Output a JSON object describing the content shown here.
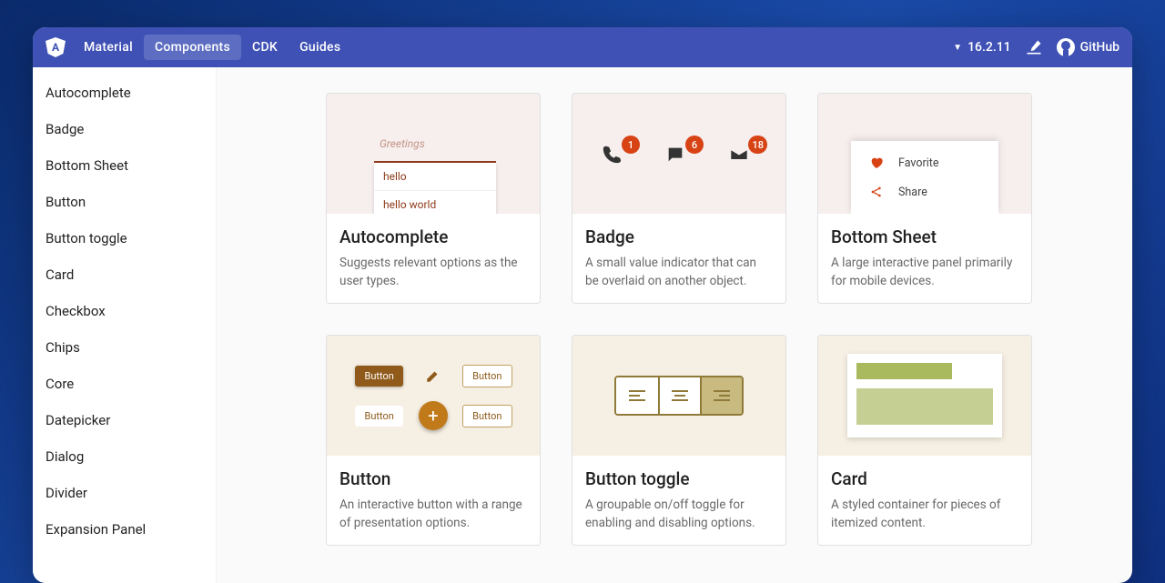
{
  "nav": {
    "brand": "Material",
    "items": [
      {
        "label": "Components"
      },
      {
        "label": "CDK"
      },
      {
        "label": "Guides"
      }
    ],
    "version": "16.2.11",
    "github": "GitHub"
  },
  "sidebar": {
    "items": [
      {
        "label": "Autocomplete"
      },
      {
        "label": "Badge"
      },
      {
        "label": "Bottom Sheet"
      },
      {
        "label": "Button"
      },
      {
        "label": "Button toggle"
      },
      {
        "label": "Card"
      },
      {
        "label": "Checkbox"
      },
      {
        "label": "Chips"
      },
      {
        "label": "Core"
      },
      {
        "label": "Datepicker"
      },
      {
        "label": "Dialog"
      },
      {
        "label": "Divider"
      },
      {
        "label": "Expansion Panel"
      }
    ]
  },
  "cards": [
    {
      "title": "Autocomplete",
      "desc": "Suggests relevant options as the user types."
    },
    {
      "title": "Badge",
      "desc": "A small value indicator that can be overlaid on another object."
    },
    {
      "title": "Bottom Sheet",
      "desc": "A large interactive panel primarily for mobile devices."
    },
    {
      "title": "Button",
      "desc": "An interactive button with a range of presentation options."
    },
    {
      "title": "Button toggle",
      "desc": "A groupable on/off toggle for enabling and disabling options."
    },
    {
      "title": "Card",
      "desc": "A styled container for pieces of itemized content."
    }
  ],
  "preview": {
    "autocomplete": {
      "placeholder": "Greetings",
      "options": [
        "hello",
        "hello world"
      ]
    },
    "badge": {
      "v": [
        "1",
        "6",
        "18"
      ]
    },
    "bottomsheet": {
      "fav": "Favorite",
      "share": "Share"
    },
    "button": {
      "label": "Button"
    }
  }
}
